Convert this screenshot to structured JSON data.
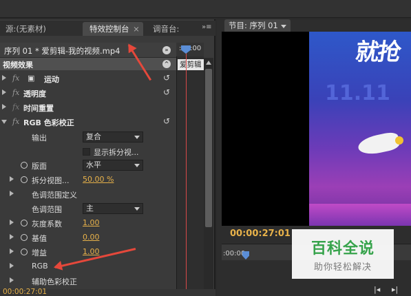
{
  "tabs": {
    "source": "源:(无素材)",
    "effect_controls": "特效控制台",
    "audio_mixer": "调音台: ",
    "program": "节目: 序列 01"
  },
  "sequence_line": "序列 01 * 爱剪辑-我的视频.mp4",
  "video_effects_header": "视频效果",
  "timeline_clip_label": "爱剪辑",
  "ruler_start": ":00:00",
  "effects": [
    {
      "label": "运动",
      "fx": "fx",
      "bold": true
    },
    {
      "label": "透明度",
      "fx": "fx",
      "bold": true
    },
    {
      "label": "时间重置",
      "fx": "fx",
      "bold": true
    },
    {
      "label": "RGB 色彩校正",
      "fx": "fx",
      "bold": true
    }
  ],
  "params": {
    "output": {
      "label": "输出",
      "value": "复合"
    },
    "split_view_check": "显示拆分视...",
    "layout": {
      "label": "版面",
      "value": "水平"
    },
    "split_percent": {
      "label": "拆分视图...",
      "value": "50.00 %"
    },
    "tonal_range_def": "色调范围定义",
    "tonal_range": {
      "label": "色调范围",
      "value": "主"
    },
    "gamma": {
      "label": "灰度系数",
      "value": "1.00"
    },
    "pedestal": {
      "label": "基值",
      "value": "0.00"
    },
    "gain": {
      "label": "增益",
      "value": "1.00"
    },
    "rgb": "RGB",
    "secondary": "辅助色彩校正"
  },
  "left_timecode": "00:00:27:01",
  "program_timecode": "00:00:27:01",
  "program_ruler": ":00:00",
  "video_text": "就抢",
  "video_eleven": "11.11",
  "watermark": {
    "title": "百科全说",
    "subtitle": "助你轻松解决"
  },
  "colors": {
    "accent_timecode": "#e8b24a",
    "playhead": "#d94a4a",
    "arrow": "#e5483b",
    "watermark_green": "#36a34b"
  }
}
